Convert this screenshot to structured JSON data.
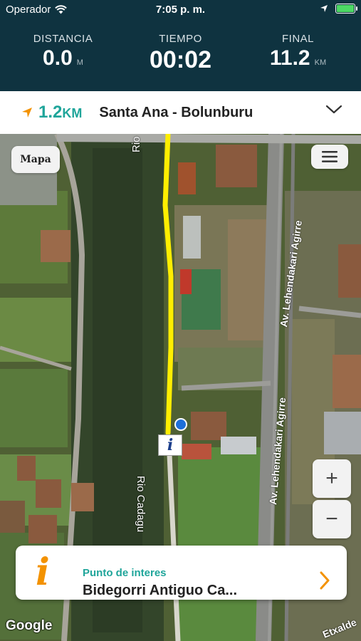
{
  "status": {
    "carrier": "Operador",
    "time": "7:05 p. m."
  },
  "stats": {
    "distance_label": "DISTANCIA",
    "distance_value": "0.0",
    "distance_unit": "M",
    "time_label": "TIEMPO",
    "time_value": "00:02",
    "final_label": "FINAL",
    "final_value": "11.2",
    "final_unit": "KM"
  },
  "route": {
    "distance_value": "1.2",
    "distance_unit": "KM",
    "name": "Santa Ana - Bolunburu"
  },
  "map": {
    "map_button_label": "Mapa",
    "zoom_in_label": "+",
    "zoom_out_label": "−",
    "labels": {
      "river_top": "Rio",
      "river_bottom": "Rio Cadagu",
      "street_upper": "Av. Lehendakari Agirre",
      "street_lower": "Av. Lehendakari Agirre",
      "street_bottom_right": "Etxalde",
      "google": "Google"
    },
    "poi_marker": "i"
  },
  "poi_card": {
    "category": "Punto de interes",
    "title": "Bidegorri Antiguo Ca..."
  },
  "colors": {
    "header_bg": "#0f3340",
    "accent_teal": "#1fa59a",
    "accent_orange": "#f39200",
    "route_line": "#ffee00"
  }
}
